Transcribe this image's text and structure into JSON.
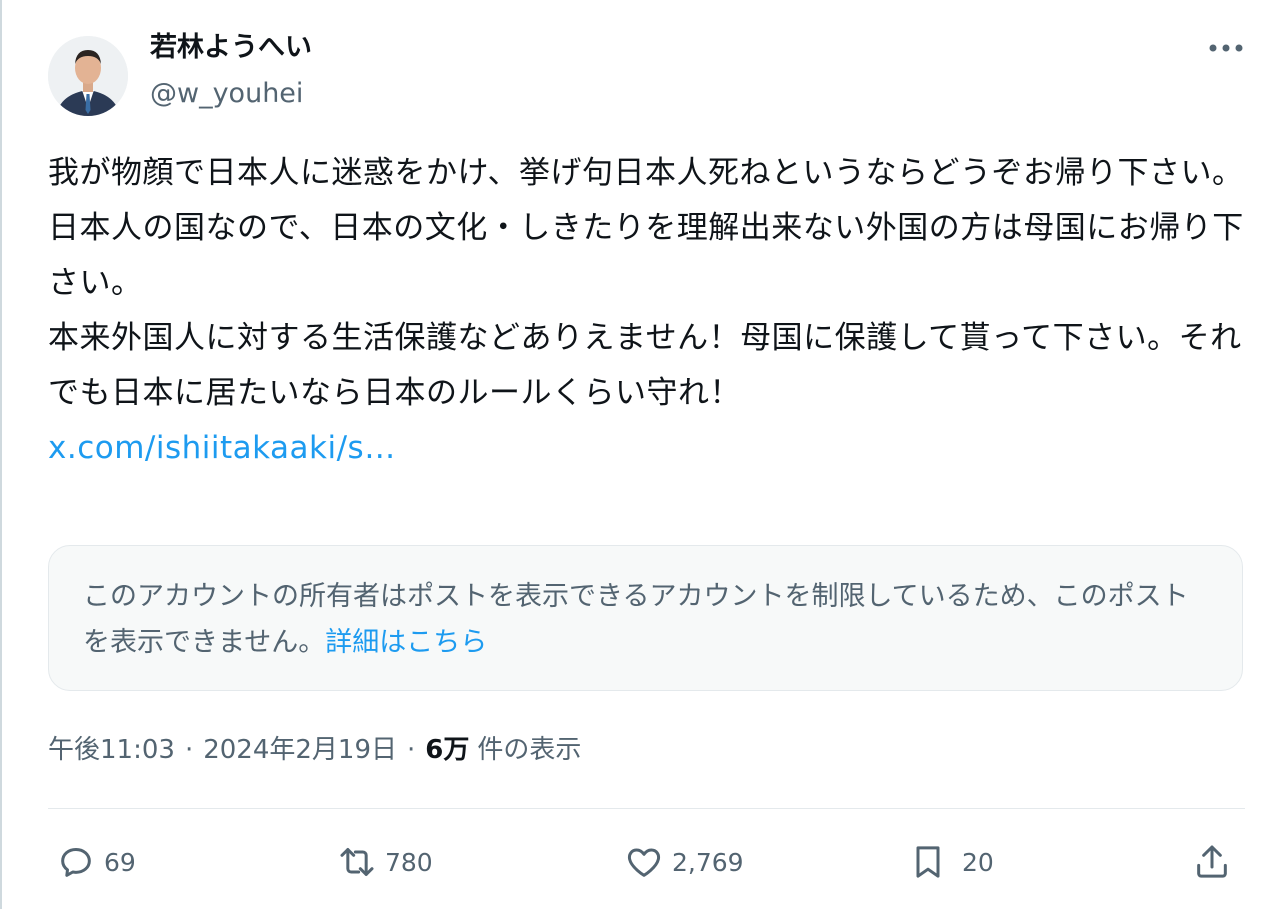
{
  "author": {
    "name": "若林ようへい",
    "handle": "@w_youhei"
  },
  "post": {
    "lines": [
      "我が物顔で日本人に迷惑をかけ、挙げ句日本人死ねというならどうぞお帰り下さい。",
      "日本人の国なので、日本の文化・しきたりを理解出来ない外国の方は母国にお帰り下さい。",
      "本来外国人に対する生活保護などありえません！母国に保護して貰って下さい。それでも日本に居たいなら日本のルールくらい守れ！"
    ],
    "link": "x.com/ishiitakaaki/s…"
  },
  "notice": {
    "text": "このアカウントの所有者はポストを表示できるアカウントを制限しているため、このポストを表示できません。",
    "link": "詳細はこちら"
  },
  "meta": {
    "time": "午後11:03",
    "date": "2024年2月19日",
    "views": "6万",
    "views_label": "件の表示",
    "separator": "·"
  },
  "actions": {
    "replies": "69",
    "reposts": "780",
    "likes": "2,769",
    "bookmarks": "20"
  },
  "icons": {
    "more": "more-dots-icon",
    "reply": "reply-icon",
    "repost": "repost-icon",
    "like": "heart-icon",
    "bookmark": "bookmark-icon",
    "share": "share-icon"
  },
  "colors": {
    "link": "#1d9bf0",
    "secondary_text": "#536471",
    "primary_text": "#0f1419"
  }
}
